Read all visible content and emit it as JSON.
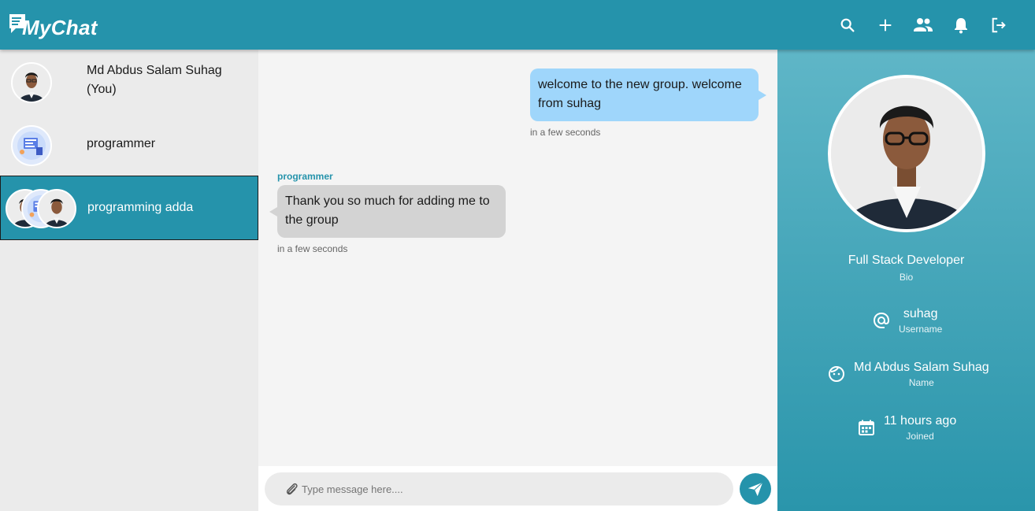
{
  "app": {
    "logo_text": "MyChat"
  },
  "header": {
    "icons": [
      "search-icon",
      "add-icon",
      "users-icon",
      "bell-icon",
      "logout-icon"
    ]
  },
  "sidebar": {
    "items": [
      {
        "name": "Md Abdus Salam Suhag (You)",
        "active": false
      },
      {
        "name": "programmer",
        "active": false
      },
      {
        "name": "programming adda",
        "active": true
      }
    ]
  },
  "chat": {
    "messages": [
      {
        "from_me": true,
        "text": "welcome to the new group. welcome from suhag",
        "time": "in a few seconds"
      },
      {
        "from_me": false,
        "sender": "programmer",
        "text": "Thank you so much for adding me to the group",
        "time": "in a few seconds"
      }
    ],
    "composer": {
      "placeholder": "Type message here...."
    }
  },
  "profile": {
    "bio": "Full Stack Developer",
    "bio_label": "Bio",
    "username": "suhag",
    "username_label": "Username",
    "name": "Md Abdus Salam Suhag",
    "name_label": "Name",
    "joined": "11 hours ago",
    "joined_label": "Joined"
  },
  "colors": {
    "accent": "#2593ab",
    "bubble_me": "#9fd6fb",
    "bubble_other": "#d3d3d3"
  }
}
